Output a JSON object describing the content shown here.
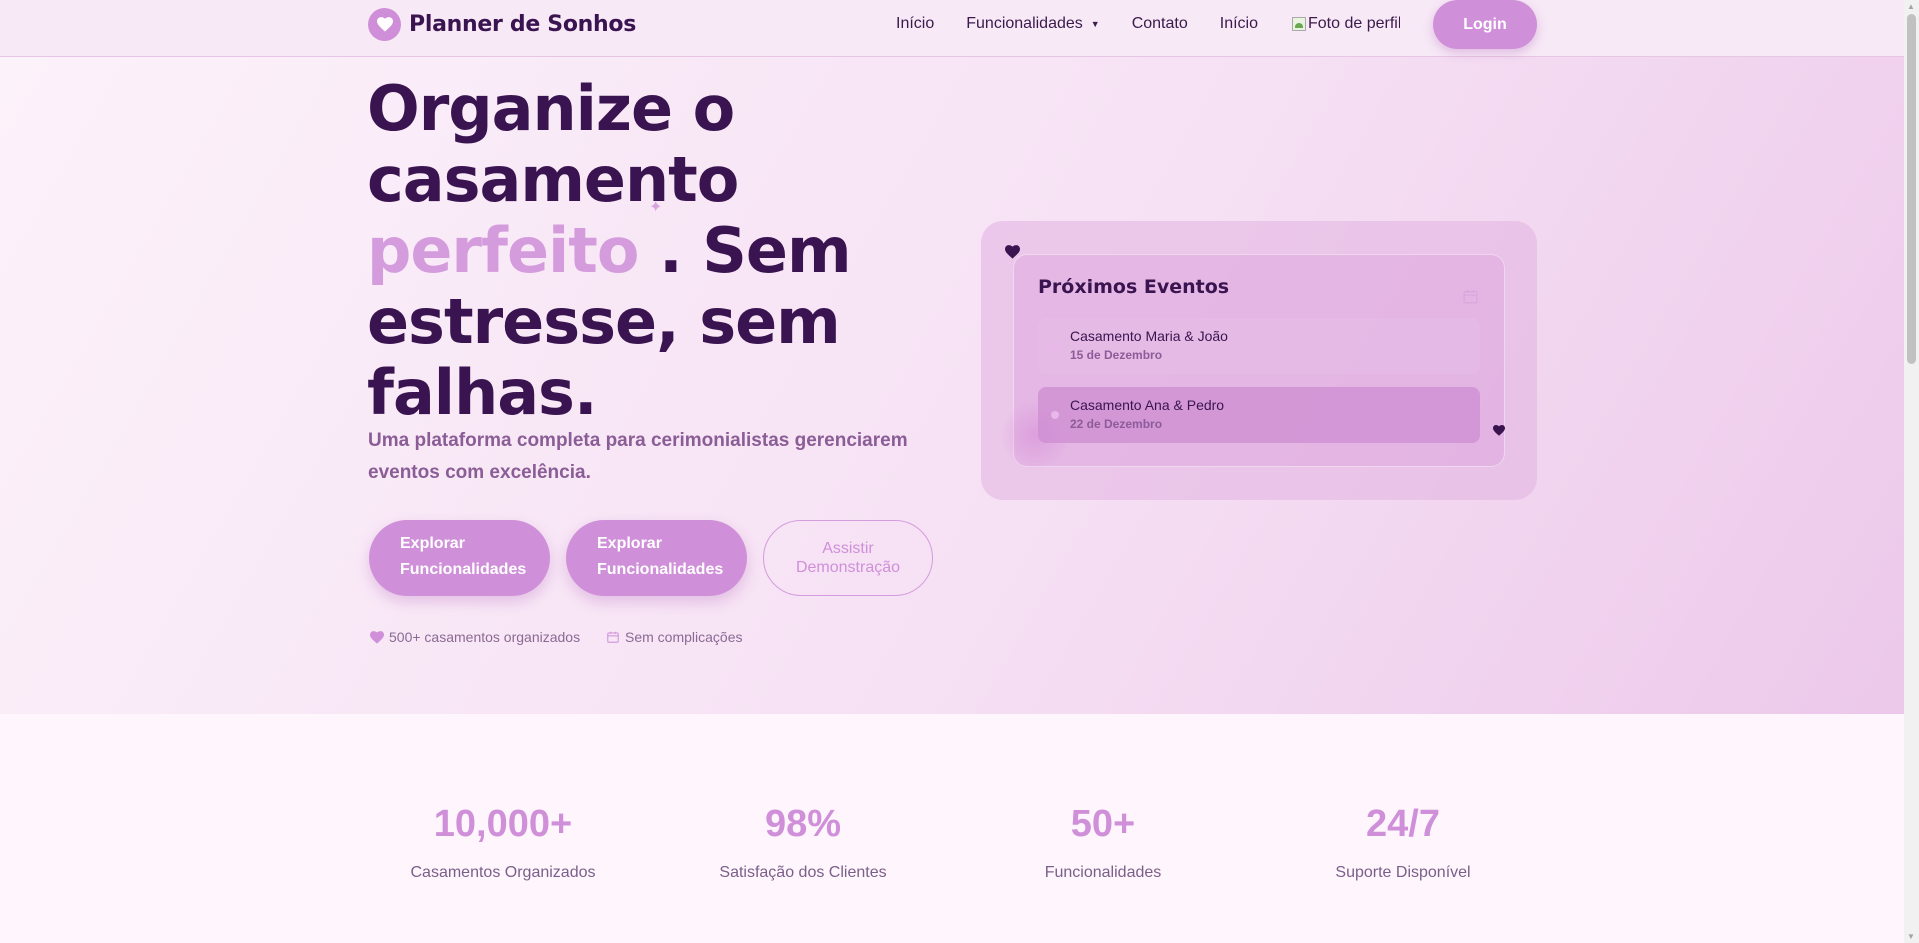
{
  "colors": {
    "brand": "#cf90d9",
    "heading": "#3a1450",
    "accent_text": "#d49cdc",
    "muted_text": "#8a5d96"
  },
  "nav": {
    "brand_name": "Planner de Sonhos",
    "brand_icon": "heart-icon",
    "links": [
      "Início",
      "Funcionalidades",
      "Contato",
      "Início"
    ],
    "avatar_alt": "Foto de perfil",
    "login_label": "Login"
  },
  "hero": {
    "title_line1": "Organize o",
    "title_line2": "casamento",
    "title_accent": "perfeito",
    "title_rest_a": " . Sem",
    "title_line4": "estresse, sem",
    "title_line5": "falhas.",
    "subtitle": "Uma plataforma completa para cerimonialistas gerenciarem eventos com excelência.",
    "btn_primary_1_line1": "Explorar",
    "btn_primary_1_line2": "Funcionalidades",
    "btn_primary_2_line1": "Explorar",
    "btn_primary_2_line2": "Funcionalidades",
    "btn_demo_line1": "Assistir",
    "btn_demo_line2": "Demonstração",
    "trust_1": "500+ casamentos organizados",
    "trust_2": "Sem complicações"
  },
  "events_card": {
    "title": "Próximos Eventos",
    "events": [
      {
        "name": "Casamento Maria & João",
        "date": "15 de Dezembro"
      },
      {
        "name": "Casamento Ana & Pedro",
        "date": "22 de Dezembro"
      }
    ]
  },
  "stats": [
    {
      "value": "10,000+",
      "label": "Casamentos Organizados"
    },
    {
      "value": "98%",
      "label": "Satisfação dos Clientes"
    },
    {
      "value": "50+",
      "label": "Funcionalidades"
    },
    {
      "value": "24/7",
      "label": "Suporte Disponível"
    }
  ]
}
